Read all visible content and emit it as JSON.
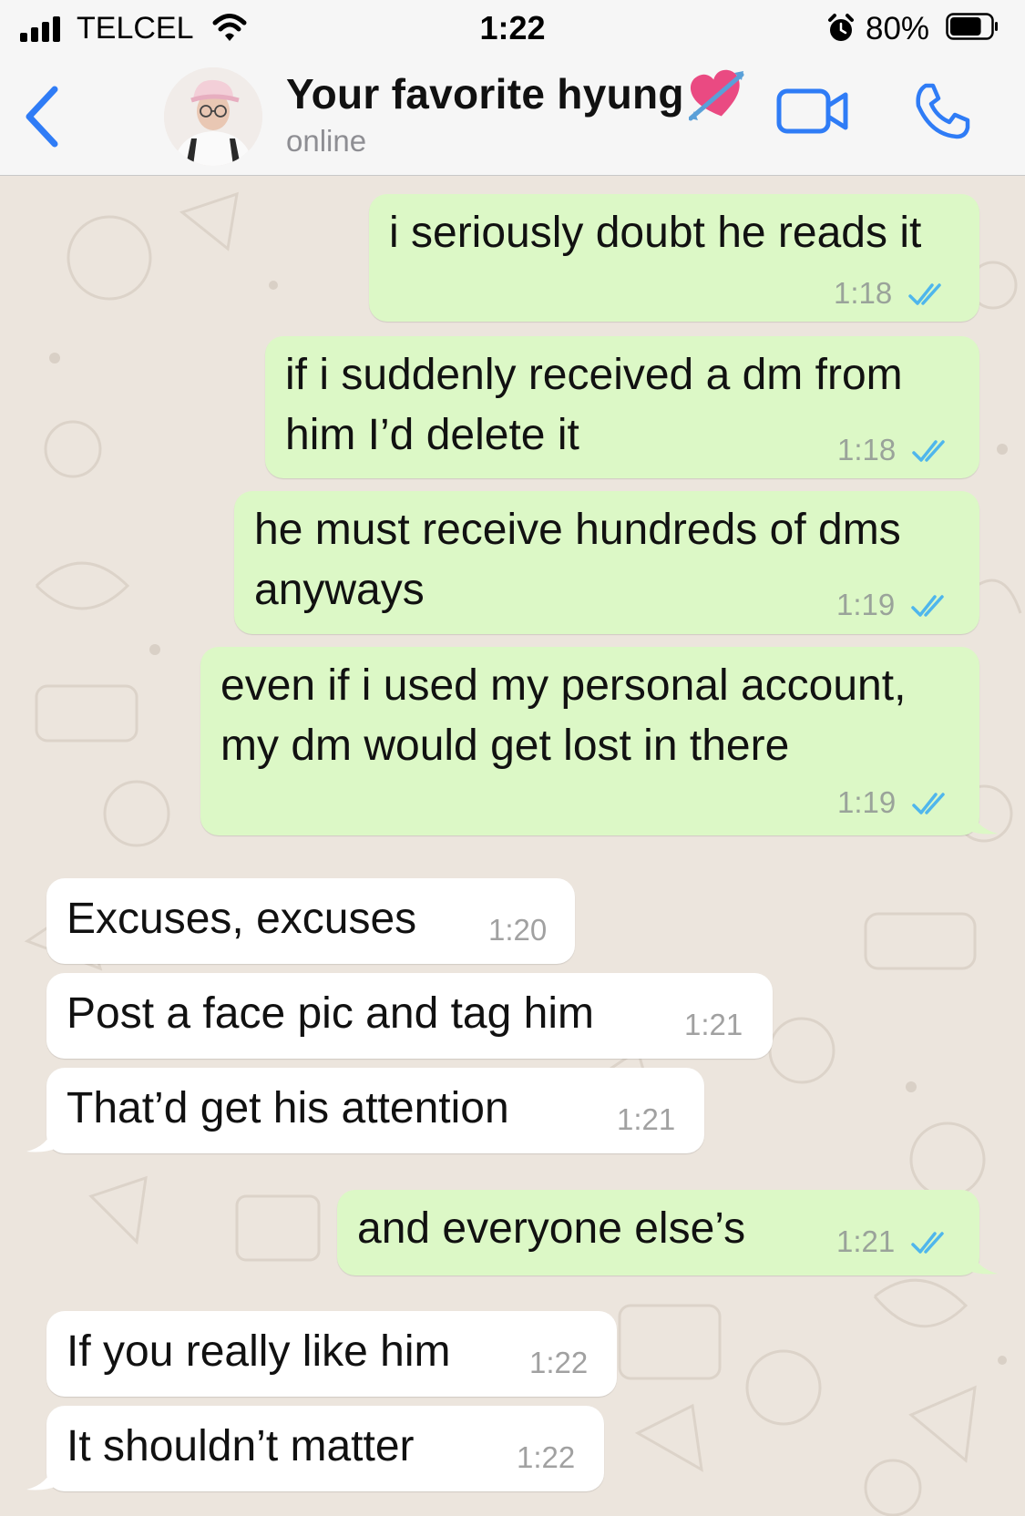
{
  "status_bar": {
    "carrier": "TELCEL",
    "time": "1:22",
    "battery_percent": "80%",
    "battery_level": 0.8
  },
  "header": {
    "contact_name": "Your favorite hyung",
    "status": "online",
    "name_emoji": "heart-with-arrow-icon"
  },
  "messages": [
    {
      "direction": "outgoing",
      "text": "i seriously doubt he reads it",
      "time": "1:18",
      "read": true
    },
    {
      "direction": "outgoing",
      "text": "if i suddenly received a dm from\nhim I’d delete it",
      "time": "1:18",
      "read": true
    },
    {
      "direction": "outgoing",
      "text": "he must receive hundreds of dms\nanyways",
      "time": "1:19",
      "read": true
    },
    {
      "direction": "outgoing",
      "text": "even if i used my personal account,\nmy dm would get lost in there",
      "time": "1:19",
      "read": true
    },
    {
      "direction": "incoming",
      "text": "Excuses, excuses",
      "time": "1:20"
    },
    {
      "direction": "incoming",
      "text": "Post a face pic and tag him",
      "time": "1:21"
    },
    {
      "direction": "incoming",
      "text": "That’d get his attention",
      "time": "1:21"
    },
    {
      "direction": "outgoing",
      "text": "and everyone else’s",
      "time": "1:21",
      "read": true
    },
    {
      "direction": "incoming",
      "text": "If you really like him",
      "time": "1:22"
    },
    {
      "direction": "incoming",
      "text": "It shouldn’t matter",
      "time": "1:22"
    }
  ],
  "colors": {
    "accent": "#2f7cf6",
    "outgoing_bubble": "#dcf8c6",
    "incoming_bubble": "#ffffff",
    "chat_background": "#ece5dd",
    "read_ticks": "#4fb6ec"
  }
}
